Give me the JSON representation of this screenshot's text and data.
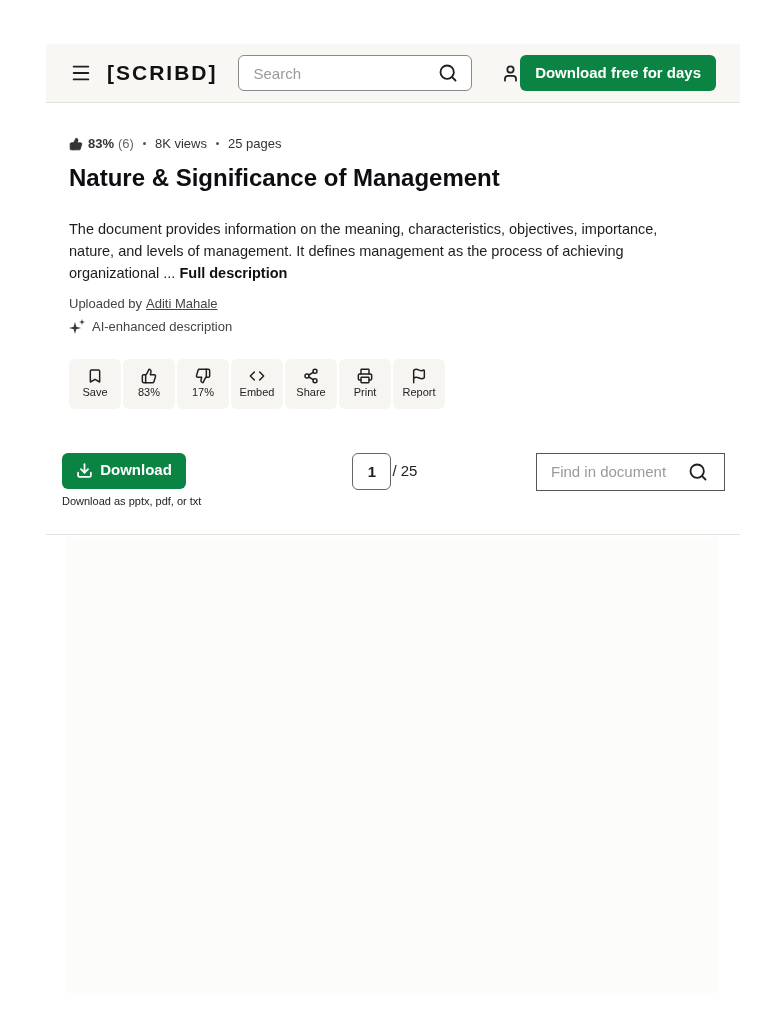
{
  "header": {
    "logo": "[SCRIBD]",
    "search": {
      "placeholder": "Search"
    },
    "cta_button": "Download free for days"
  },
  "document": {
    "rating": "83%",
    "rating_count": "(6)",
    "views": "8K views",
    "pages": "25 pages",
    "title": "Nature & Significance of Management",
    "description": "The document provides information on the meaning, characteristics, objectives, importance, nature, and levels of management. It defines management as the process of achieving organizational ...",
    "description_more": "Full description",
    "uploaded_by_label": "Uploaded by",
    "uploader": "Aditi Mahale",
    "ai_note": "AI-enhanced description"
  },
  "actions": [
    {
      "kind": "save",
      "label": "Save"
    },
    {
      "kind": "like",
      "label": "83%"
    },
    {
      "kind": "dislike",
      "label": "17%"
    },
    {
      "kind": "embed",
      "label": "Embed"
    },
    {
      "kind": "share",
      "label": "Share"
    },
    {
      "kind": "print",
      "label": "Print"
    },
    {
      "kind": "report",
      "label": "Report"
    }
  ],
  "toolbar": {
    "download_button": "Download",
    "download_note": "Download as pptx, pdf, or txt",
    "page_input": "1",
    "page_total": "/ 25",
    "find": {
      "placeholder": "Find in document"
    }
  }
}
